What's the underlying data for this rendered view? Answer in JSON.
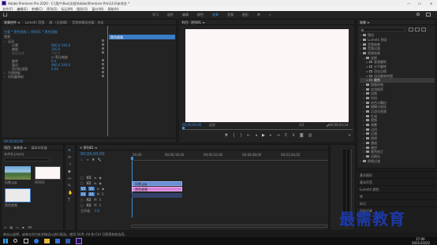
{
  "app": {
    "title": "Adobe Premiere Pro 2020 - C:\\用户\\Roo\\文档\\Adobe\\Premiere Pro\\14.0\\未命名 *",
    "window_buttons": [
      "—",
      "☐",
      "✕"
    ],
    "menu": [
      "文件(F)",
      "编辑(E)",
      "剪辑(C)",
      "序列(S)",
      "标记(M)",
      "图形(G)",
      "窗口(W)",
      "帮助(H)"
    ]
  },
  "workspaces": {
    "items": [
      "学习",
      "组件",
      "编辑",
      "颜色",
      "效果",
      "音频",
      "图形",
      "库"
    ],
    "active": "效果",
    "more": "»"
  },
  "effect_controls": {
    "tabs": [
      "效果控件 ≡",
      "Lumetri 范围",
      "源：(无剪辑)",
      "音频剪辑混合器：合成"
    ],
    "clip_path": "主要 * 黑色视频 ∨ 序列01 * 黑色视频",
    "mini_clip_label": "黑色视频",
    "section_video": "视频",
    "rows": [
      {
        "label": "运动",
        "value": "",
        "indent": 1
      },
      {
        "label": "位置",
        "value": "960.0    540.0",
        "indent": 2
      },
      {
        "label": "缩放",
        "value": "100.0",
        "indent": 2
      },
      {
        "label": "缩放宽度",
        "value": "100.0",
        "indent": 2
      },
      {
        "label": "",
        "value": "☑ 等比缩放",
        "indent": 3
      },
      {
        "label": "旋转",
        "value": "0.0",
        "indent": 2
      },
      {
        "label": "锚点",
        "value": "960.0    540.0",
        "indent": 2
      },
      {
        "label": "防闪烁滤镜",
        "value": "0.00",
        "indent": 2
      },
      {
        "label": "不透明度",
        "value": "",
        "indent": 1
      },
      {
        "label": "时间重映射",
        "value": "",
        "indent": 1
      }
    ],
    "timecode": "00;00;00;00"
  },
  "program_monitor": {
    "tab": "节目：序列01 ≡",
    "timecode": "00;00;00;00",
    "fit": "适合",
    "ratio": "1/2",
    "duration": "00;00;04;24"
  },
  "effects": {
    "tab": "效果 ≡",
    "search_placeholder": "",
    "tree": [
      {
        "label": "预设",
        "depth": 0
      },
      {
        "label": "Lumetri 预设",
        "depth": 0
      },
      {
        "label": "音频效果",
        "depth": 0
      },
      {
        "label": "音频过渡",
        "depth": 0
      },
      {
        "label": "视频效果",
        "depth": 0
      },
      {
        "label": "变换",
        "depth": 1,
        "open": true
      },
      {
        "label": "垂直翻转",
        "depth": 2
      },
      {
        "label": "水平翻转",
        "depth": 2
      },
      {
        "label": "羽化边缘",
        "depth": 2
      },
      {
        "label": "自动重新构图",
        "depth": 2
      },
      {
        "label": "裁剪",
        "depth": 2,
        "selected": true
      },
      {
        "label": "图像控制",
        "depth": 1
      },
      {
        "label": "实用程序",
        "depth": 1
      },
      {
        "label": "扭曲",
        "depth": 1
      },
      {
        "label": "时间",
        "depth": 1
      },
      {
        "label": "杂色与颗粒",
        "depth": 1
      },
      {
        "label": "模糊与锐化",
        "depth": 1
      },
      {
        "label": "沉浸式视频",
        "depth": 1
      },
      {
        "label": "生成",
        "depth": 1
      },
      {
        "label": "视频",
        "depth": 1
      },
      {
        "label": "调整",
        "depth": 1
      },
      {
        "label": "过时",
        "depth": 1
      },
      {
        "label": "过渡",
        "depth": 1
      },
      {
        "label": "透视",
        "depth": 1
      },
      {
        "label": "通道",
        "depth": 1
      },
      {
        "label": "键控",
        "depth": 1
      },
      {
        "label": "颜色校正",
        "depth": 1
      },
      {
        "label": "风格化",
        "depth": 1
      },
      {
        "label": "视频过渡",
        "depth": 0
      }
    ],
    "panels_below": [
      "基本图形",
      "基本声音",
      "Lumetri 颜色",
      "库",
      "标记",
      "历史记录"
    ]
  },
  "project": {
    "tabs": [
      "项目：未命名 ≡",
      "媒体浏览器"
    ],
    "file": "未命名.prproj",
    "items": [
      {
        "name": "风景.jpg",
        "kind": "image"
      },
      {
        "name": "序列01",
        "kind": "sequence"
      },
      {
        "name": "黑色视频",
        "kind": "black"
      }
    ]
  },
  "timeline": {
    "tab": "× 序列01 ≡",
    "timecode": "00;00;00;00",
    "ruler": [
      "00;00",
      "00;00;16;00",
      "00;00;32;00",
      "00;00;48;00",
      "00;01;04;02",
      "00;01;20;02"
    ],
    "tracks": [
      {
        "name": "V3",
        "type": "video"
      },
      {
        "name": "V2",
        "type": "video"
      },
      {
        "name": "V1",
        "type": "video"
      },
      {
        "name": "A1",
        "type": "audio"
      },
      {
        "name": "A2",
        "type": "audio"
      },
      {
        "name": "A3",
        "type": "audio"
      }
    ],
    "master": "主声道",
    "master_value": "0.0",
    "clips": [
      {
        "label": "风景.jpg",
        "track": "V2"
      },
      {
        "label": "黑色视频",
        "track": "V1"
      }
    ]
  },
  "status": {
    "text": "单击以选择，或单击空白处并拖动以进行框选。使用 Shift, Alt 和 Ctrl 可获得其他选项。"
  },
  "taskbar": {
    "time": "17:00",
    "date": "2021/10/22"
  },
  "watermark": "最需教育",
  "colors": {
    "accent": "#3e90d8",
    "clip_pink": "#d57fd6",
    "clip_blue": "#6b8fd6",
    "monitor_bg": "#fdf6f6"
  }
}
